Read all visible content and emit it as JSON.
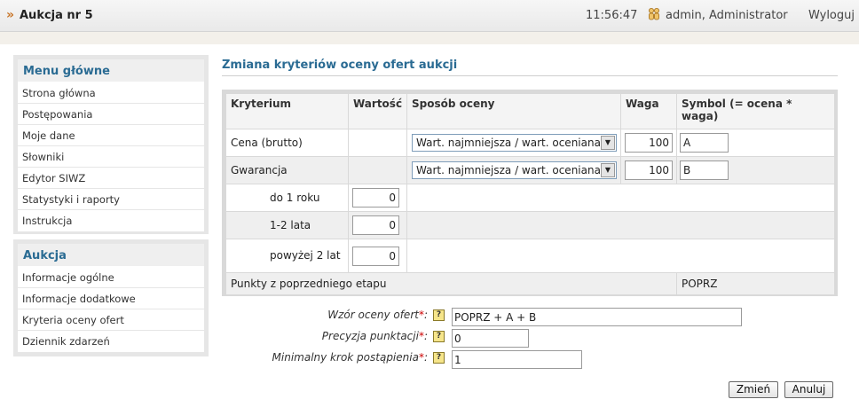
{
  "header": {
    "title": "Aukcja nr 5",
    "time": "11:56:47",
    "user": "admin, Administrator",
    "logout": "Wyloguj"
  },
  "menu_main": {
    "title": "Menu główne",
    "items": [
      "Strona główna",
      "Postępowania",
      "Moje dane",
      "Słowniki",
      "Edytor SIWZ",
      "Statystyki i raporty",
      "Instrukcja"
    ]
  },
  "menu_auction": {
    "title": "Aukcja",
    "items": [
      "Informacje ogólne",
      "Informacje dodatkowe",
      "Kryteria oceny ofert",
      "Dziennik zdarzeń"
    ]
  },
  "main": {
    "title": "Zmiana kryteriów oceny ofert aukcji",
    "columns": [
      "Kryterium",
      "Wartość",
      "Sposób oceny",
      "Waga",
      "Symbol (= ocena * waga)"
    ],
    "rows": {
      "cena": {
        "label": "Cena (brutto)",
        "method": "Wart. najmniejsza / wart. oceniana",
        "weight": "100",
        "symbol": "A"
      },
      "gwarancja": {
        "label": "Gwarancja",
        "method": "Wart. najmniejsza / wart. oceniana",
        "weight": "100",
        "symbol": "B"
      },
      "sub": [
        {
          "label": "do 1 roku",
          "value": "0"
        },
        {
          "label": "1-2 lata",
          "value": "0"
        },
        {
          "label": "powyżej 2 lat",
          "value": "0"
        }
      ],
      "prev": {
        "label": "Punkty z poprzedniego etapu",
        "symbol": "POPRZ"
      }
    }
  },
  "form": {
    "formula_label": "Wzór oceny ofert",
    "formula_value": "POPRZ + A + B",
    "precision_label": "Precyzja punktacji",
    "precision_value": "0",
    "step_label": "Minimalny krok postąpienia",
    "step_value": "1",
    "required_mark": "*",
    "help_glyph": "?"
  },
  "buttons": {
    "save": "Zmień",
    "cancel": "Anuluj"
  },
  "icons": {
    "header_chevron": "»",
    "select_arrow": "▼"
  },
  "colors": {
    "accent": "#2a6b93",
    "required": "#cc0000"
  }
}
